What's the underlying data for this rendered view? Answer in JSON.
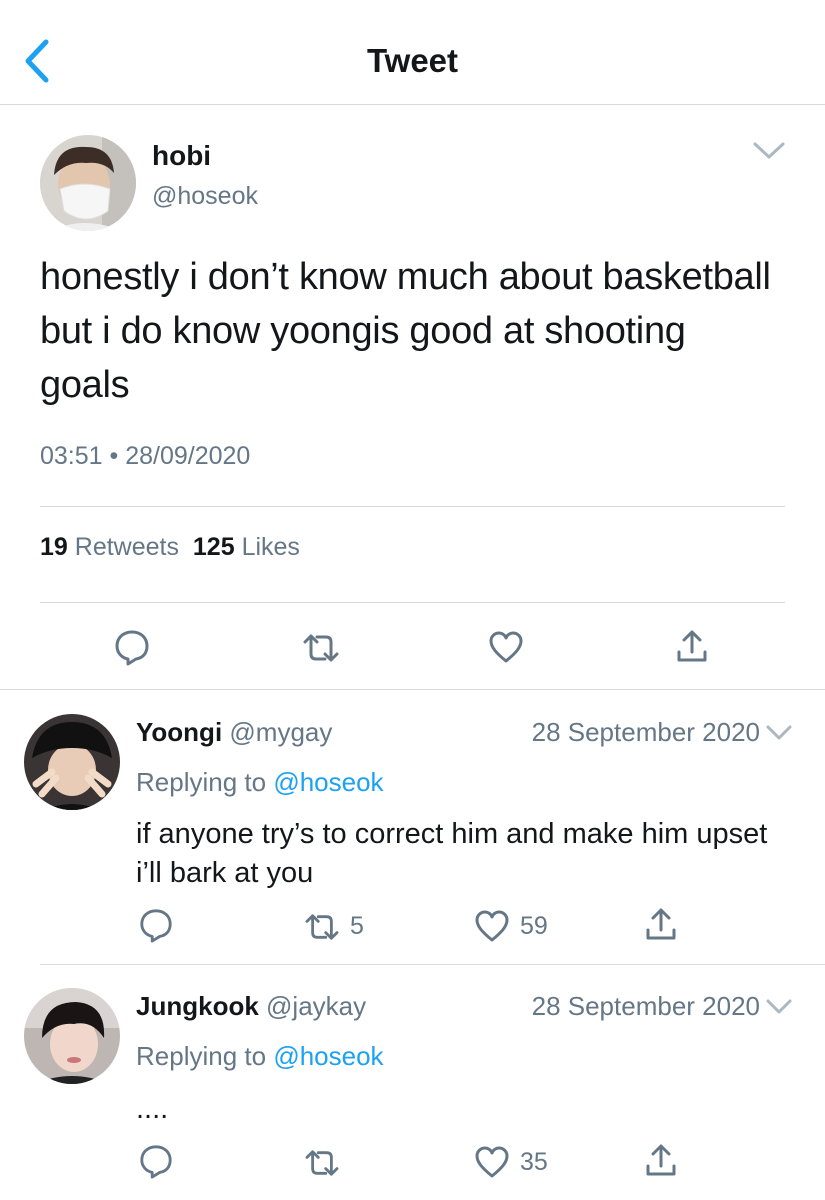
{
  "header": {
    "title": "Tweet",
    "back_icon": "chevron-left-icon",
    "accent": "#1da1f2"
  },
  "tweet": {
    "name": "hobi",
    "handle": "@hoseok",
    "text": "honestly i don’t know much about basketball but i do know yoongis good at shooting goals",
    "time": "03:51 • 28/09/2020",
    "retweets_count": "19",
    "retweets_label": "Retweets",
    "likes_count": "125",
    "likes_label": "Likes",
    "actions": [
      "reply-icon",
      "retweet-icon",
      "like-icon",
      "share-icon"
    ]
  },
  "replies": [
    {
      "name": "Yoongi",
      "handle": "@mygay",
      "date": "28 September 2020",
      "replying_prefix": "Replying to",
      "replying_to": "@hoseok",
      "text": "if anyone try’s to correct him and make him upset i’ll bark at you",
      "retweets": "5",
      "likes": "59"
    },
    {
      "name": "Jungkook",
      "handle": "@jaykay",
      "date": "28 September 2020",
      "replying_prefix": "Replying to",
      "replying_to": "@hoseok",
      "text": "....",
      "retweets": "",
      "likes": "35"
    }
  ],
  "colors": {
    "text": "#14171a",
    "secondary": "#657786",
    "link": "#1da1f2",
    "divider": "#d6dadd"
  }
}
